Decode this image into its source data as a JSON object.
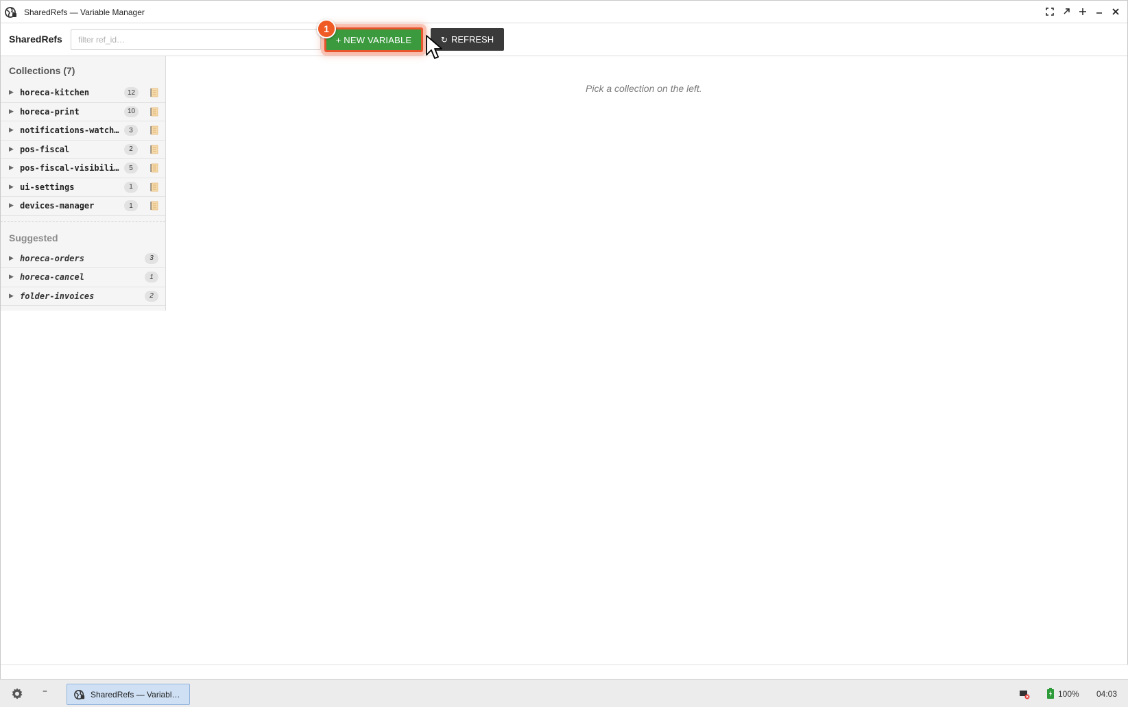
{
  "window": {
    "title": "SharedRefs — Variable Manager",
    "controls": [
      "fullscreen-icon",
      "restore-icon",
      "maximize-icon",
      "minimize-icon",
      "close-icon"
    ]
  },
  "toolbar": {
    "brand": "SharedRefs",
    "filter_placeholder": "filter ref_id…",
    "filter_value": "",
    "new_variable_label": "+ NEW VARIABLE",
    "step_badge": "1",
    "refresh_label": "REFRESH"
  },
  "sidebar": {
    "collections_title": "Collections (7)",
    "collections": [
      {
        "name": "horeca-kitchen",
        "count": "12"
      },
      {
        "name": "horeca-print",
        "count": "10"
      },
      {
        "name": "notifications-watch…",
        "count": "3"
      },
      {
        "name": "pos-fiscal",
        "count": "2"
      },
      {
        "name": "pos-fiscal-visibili…",
        "count": "5"
      },
      {
        "name": "ui-settings",
        "count": "1"
      },
      {
        "name": "devices-manager",
        "count": "1"
      }
    ],
    "suggested_title": "Suggested",
    "suggested": [
      {
        "name": "horeca-orders",
        "count": "3"
      },
      {
        "name": "horeca-cancel",
        "count": "1"
      },
      {
        "name": "folder-invoices",
        "count": "2"
      }
    ]
  },
  "main": {
    "hint": "Pick a collection on the left."
  },
  "taskbar": {
    "task_label": "SharedRefs — Variabl…",
    "battery": "100%",
    "clock": "04:03"
  },
  "colors": {
    "new_variable_bg": "#3b9a3e",
    "highlight": "#e8542c",
    "refresh_bg": "#3a3a3a",
    "sidebar_bg": "#f5f5f5"
  }
}
